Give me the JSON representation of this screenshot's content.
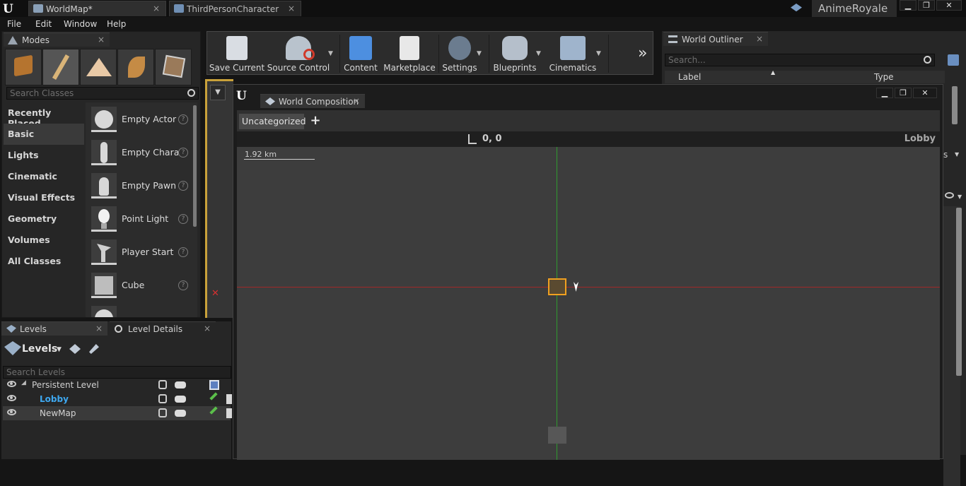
{
  "title_bar": {
    "tabs": [
      {
        "label": "WorldMap*"
      },
      {
        "label": "ThirdPersonCharacter"
      }
    ],
    "tab_close": "×",
    "project_name": "AnimeRoyale",
    "window_buttons": [
      "▁",
      "❐",
      "✕"
    ]
  },
  "menu": {
    "items": [
      "File",
      "Edit",
      "Window",
      "Help"
    ]
  },
  "modes": {
    "tab_label": "Modes",
    "close": "×",
    "search_placeholder": "Search Classes",
    "categories": [
      "Recently Placed",
      "Basic",
      "Lights",
      "Cinematic",
      "Visual Effects",
      "Geometry",
      "Volumes",
      "All Classes"
    ],
    "active_category": "Basic",
    "items": [
      {
        "label": "Empty Actor",
        "icon": "sphere-icon"
      },
      {
        "label": "Empty Chara",
        "icon": "character-icon"
      },
      {
        "label": "Empty Pawn",
        "icon": "pawn-icon"
      },
      {
        "label": "Point Light",
        "icon": "lightbulb-icon"
      },
      {
        "label": "Player Start",
        "icon": "player-start-icon"
      },
      {
        "label": "Cube",
        "icon": "cube-icon"
      }
    ],
    "help": "?"
  },
  "toolbar": {
    "buttons": [
      {
        "label": "Save Current",
        "icon": "save-icon"
      },
      {
        "label": "Source Control",
        "icon": "source-control-icon"
      },
      {
        "label": "Content",
        "icon": "content-icon"
      },
      {
        "label": "Marketplace",
        "icon": "marketplace-icon"
      },
      {
        "label": "Settings",
        "icon": "settings-icon"
      },
      {
        "label": "Blueprints",
        "icon": "blueprints-icon"
      },
      {
        "label": "Cinematics",
        "icon": "cinematics-icon"
      }
    ],
    "more": "»"
  },
  "outliner": {
    "tab_label": "World Outliner",
    "close": "×",
    "search_placeholder": "Search...",
    "columns": [
      "Label",
      "Type"
    ],
    "partial_text": "s"
  },
  "world_composition": {
    "tab_label": "World Composition",
    "close": "×",
    "window_buttons": [
      "▁",
      "❐",
      "✕"
    ],
    "layer_label": "Uncategorized",
    "add_label": "+",
    "coordinates": "0, 0",
    "level_name": "Lobby",
    "scale_label": "1.92 km"
  },
  "levels": {
    "tabs": [
      {
        "label": "Levels"
      },
      {
        "label": "Level Details"
      }
    ],
    "close": "×",
    "title": "Levels",
    "search_placeholder": "Search Levels",
    "rows": [
      {
        "name": "Persistent Level",
        "expander": "◢"
      },
      {
        "name": "Lobby"
      },
      {
        "name": "NewMap"
      }
    ],
    "colors": {
      "current_level": "#3ea8f0"
    }
  }
}
